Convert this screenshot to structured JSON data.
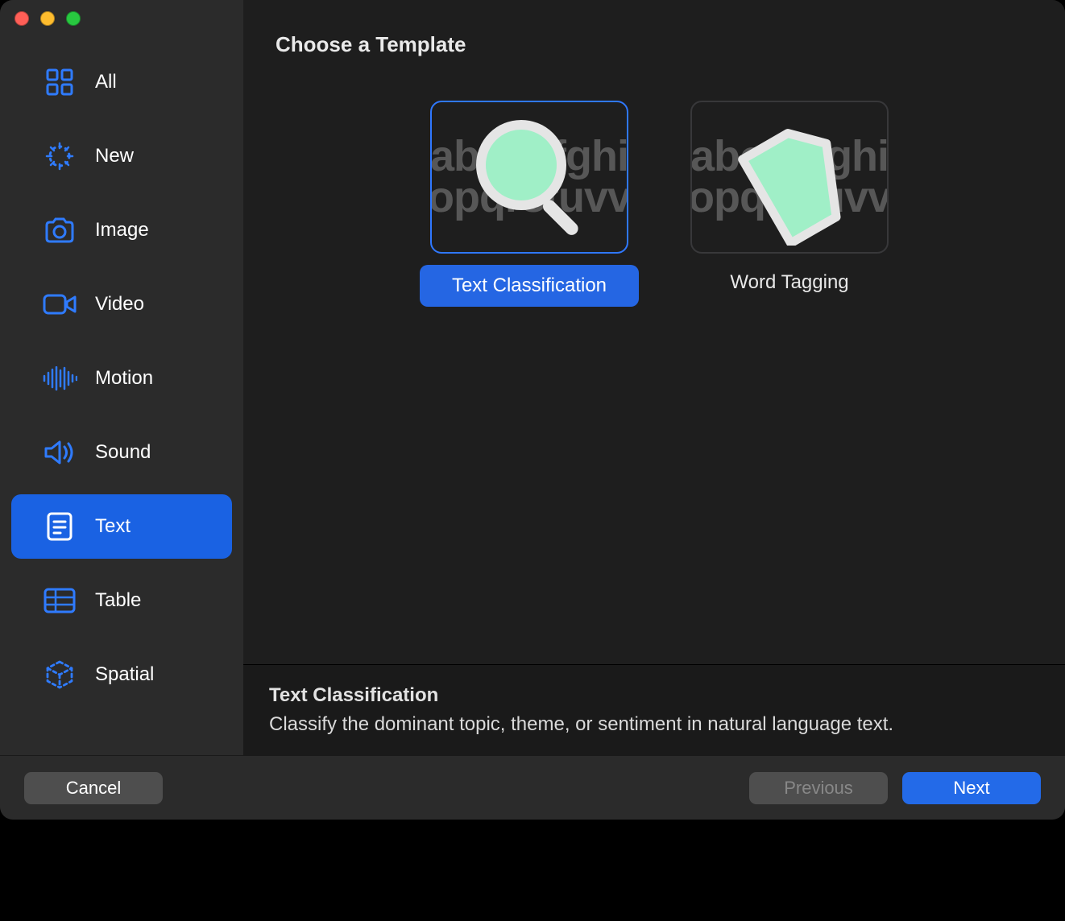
{
  "header": {
    "title": "Choose a Template"
  },
  "sidebar": {
    "items": [
      {
        "id": "all",
        "label": "All",
        "icon": "grid-icon",
        "selected": false
      },
      {
        "id": "new",
        "label": "New",
        "icon": "sparkle-icon",
        "selected": false
      },
      {
        "id": "image",
        "label": "Image",
        "icon": "camera-icon",
        "selected": false
      },
      {
        "id": "video",
        "label": "Video",
        "icon": "video-icon",
        "selected": false
      },
      {
        "id": "motion",
        "label": "Motion",
        "icon": "wave-icon",
        "selected": false
      },
      {
        "id": "sound",
        "label": "Sound",
        "icon": "speaker-icon",
        "selected": false
      },
      {
        "id": "text",
        "label": "Text",
        "icon": "text-doc-icon",
        "selected": true
      },
      {
        "id": "table",
        "label": "Table",
        "icon": "table-icon",
        "selected": false
      },
      {
        "id": "spatial",
        "label": "Spatial",
        "icon": "cube3d-icon",
        "selected": false
      }
    ]
  },
  "templates": [
    {
      "id": "text-classification",
      "label": "Text Classification",
      "selected": true
    },
    {
      "id": "word-tagging",
      "label": "Word Tagging",
      "selected": false
    }
  ],
  "info": {
    "title": "Text Classification",
    "desc": "Classify the dominant topic, theme, or sentiment in natural language text."
  },
  "footer": {
    "cancel": "Cancel",
    "previous": "Previous",
    "next": "Next"
  },
  "colors": {
    "accent": "#236ae8",
    "iconBlue": "#2f7bff",
    "mint": "#a0efc7"
  }
}
